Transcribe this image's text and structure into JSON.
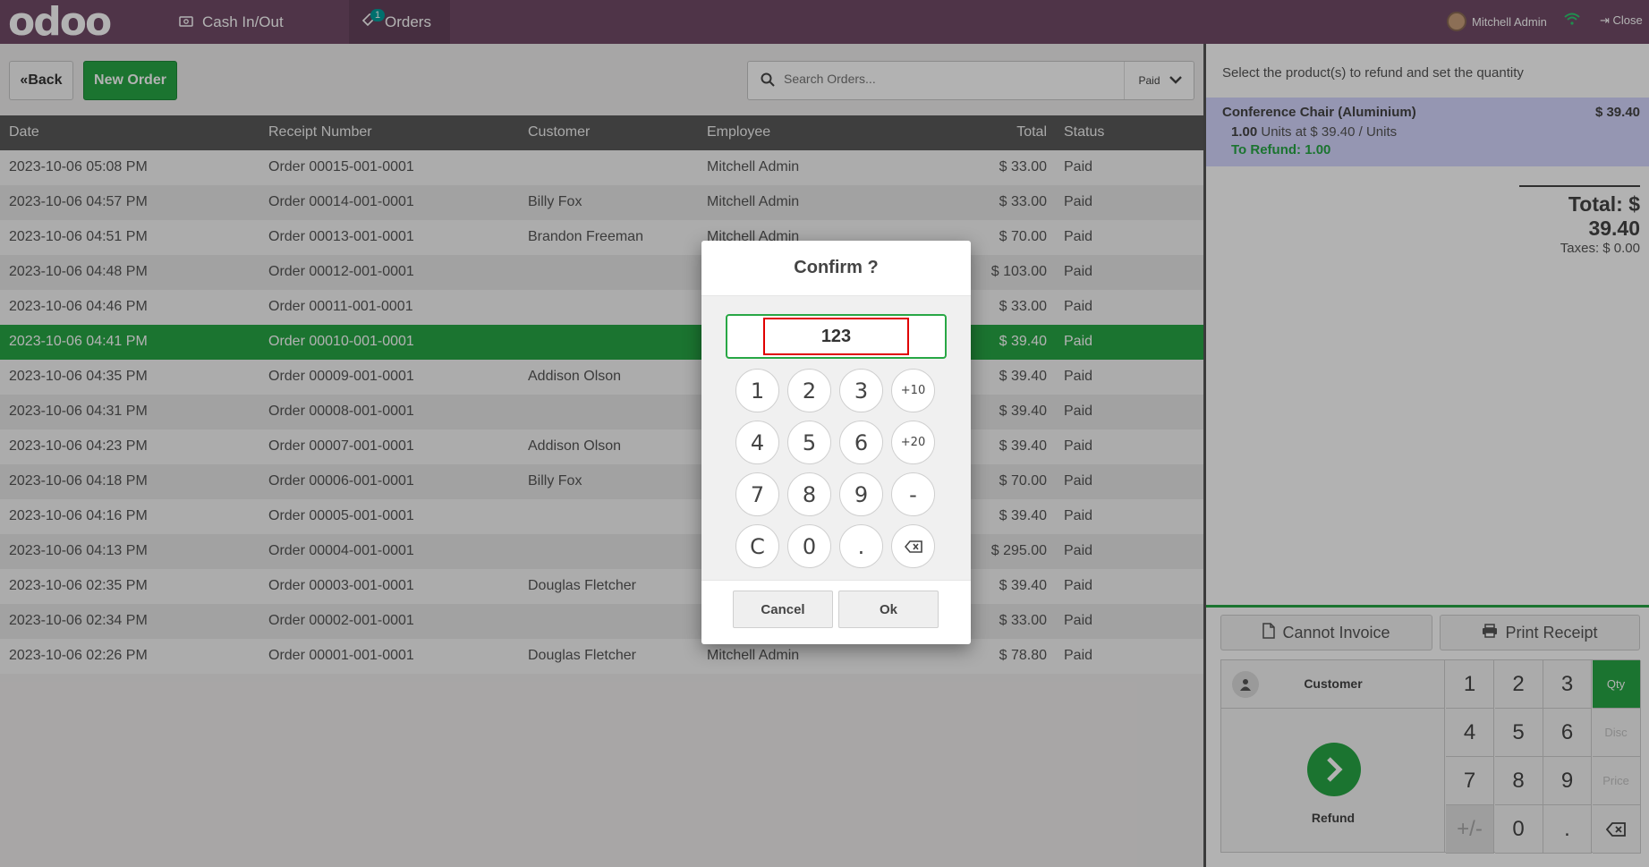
{
  "topbar": {
    "logo": "odoo",
    "cash_label": "Cash In/Out",
    "orders_label": "Orders",
    "orders_badge": "1",
    "user_name": "Mitchell Admin",
    "close_label": "Close"
  },
  "toolbar": {
    "back_label": "Back",
    "new_order_label": "New Order",
    "search_placeholder": "Search Orders...",
    "filter_value": "Paid"
  },
  "table": {
    "headers": [
      "Date",
      "Receipt Number",
      "Customer",
      "Employee",
      "Total",
      "Status"
    ],
    "rows": [
      {
        "date": "2023-10-06 05:08 PM",
        "receipt": "Order 00015-001-0001",
        "customer": "",
        "employee": "Mitchell Admin",
        "total": "$ 33.00",
        "status": "Paid"
      },
      {
        "date": "2023-10-06 04:57 PM",
        "receipt": "Order 00014-001-0001",
        "customer": "Billy Fox",
        "employee": "Mitchell Admin",
        "total": "$ 33.00",
        "status": "Paid"
      },
      {
        "date": "2023-10-06 04:51 PM",
        "receipt": "Order 00013-001-0001",
        "customer": "Brandon Freeman",
        "employee": "Mitchell Admin",
        "total": "$ 70.00",
        "status": "Paid"
      },
      {
        "date": "2023-10-06 04:48 PM",
        "receipt": "Order 00012-001-0001",
        "customer": "",
        "employee": "",
        "total": "$ 103.00",
        "status": "Paid"
      },
      {
        "date": "2023-10-06 04:46 PM",
        "receipt": "Order 00011-001-0001",
        "customer": "",
        "employee": "",
        "total": "$ 33.00",
        "status": "Paid"
      },
      {
        "date": "2023-10-06 04:41 PM",
        "receipt": "Order 00010-001-0001",
        "customer": "",
        "employee": "",
        "total": "$ 39.40",
        "status": "Paid"
      },
      {
        "date": "2023-10-06 04:35 PM",
        "receipt": "Order 00009-001-0001",
        "customer": "Addison Olson",
        "employee": "",
        "total": "$ 39.40",
        "status": "Paid"
      },
      {
        "date": "2023-10-06 04:31 PM",
        "receipt": "Order 00008-001-0001",
        "customer": "",
        "employee": "",
        "total": "$ 39.40",
        "status": "Paid"
      },
      {
        "date": "2023-10-06 04:23 PM",
        "receipt": "Order 00007-001-0001",
        "customer": "Addison Olson",
        "employee": "",
        "total": "$ 39.40",
        "status": "Paid"
      },
      {
        "date": "2023-10-06 04:18 PM",
        "receipt": "Order 00006-001-0001",
        "customer": "Billy Fox",
        "employee": "",
        "total": "$ 70.00",
        "status": "Paid"
      },
      {
        "date": "2023-10-06 04:16 PM",
        "receipt": "Order 00005-001-0001",
        "customer": "",
        "employee": "",
        "total": "$ 39.40",
        "status": "Paid"
      },
      {
        "date": "2023-10-06 04:13 PM",
        "receipt": "Order 00004-001-0001",
        "customer": "",
        "employee": "",
        "total": "$ 295.00",
        "status": "Paid"
      },
      {
        "date": "2023-10-06 02:35 PM",
        "receipt": "Order 00003-001-0001",
        "customer": "Douglas Fletcher",
        "employee": "",
        "total": "$ 39.40",
        "status": "Paid"
      },
      {
        "date": "2023-10-06 02:34 PM",
        "receipt": "Order 00002-001-0001",
        "customer": "",
        "employee": "",
        "total": "$ 33.00",
        "status": "Paid"
      },
      {
        "date": "2023-10-06 02:26 PM",
        "receipt": "Order 00001-001-0001",
        "customer": "Douglas Fletcher",
        "employee": "Mitchell Admin",
        "total": "$ 78.80",
        "status": "Paid"
      }
    ],
    "selected_row": 5
  },
  "refund_panel": {
    "instruction": "Select the product(s) to refund and set the quantity",
    "line": {
      "product": "Conference Chair (Aluminium)",
      "price": "$ 39.40",
      "qty": "1.00",
      "qty_text": "Units at $ 39.40 / Units",
      "to_refund": "To Refund: 1.00"
    },
    "total": "Total: $ 39.40",
    "taxes": "Taxes: $ 0.00",
    "cannot_invoice_label": "Cannot Invoice",
    "print_receipt_label": "Print Receipt",
    "customer_label": "Customer",
    "refund_label": "Refund",
    "keys": [
      "1",
      "2",
      "3",
      "4",
      "5",
      "6",
      "7",
      "8",
      "9",
      "+/-",
      "0",
      "."
    ],
    "modes": [
      "Qty",
      "Disc",
      "Price"
    ]
  },
  "dialog": {
    "title": "Confirm ?",
    "value": "123",
    "keys": [
      "1",
      "2",
      "3",
      "+10",
      "4",
      "5",
      "6",
      "+20",
      "7",
      "8",
      "9",
      "-",
      "C",
      "0",
      "."
    ],
    "cancel_label": "Cancel",
    "ok_label": "Ok"
  },
  "colors": {
    "brand": "#714b67",
    "accent": "#28a745",
    "highlight": "#d6d7ff"
  }
}
